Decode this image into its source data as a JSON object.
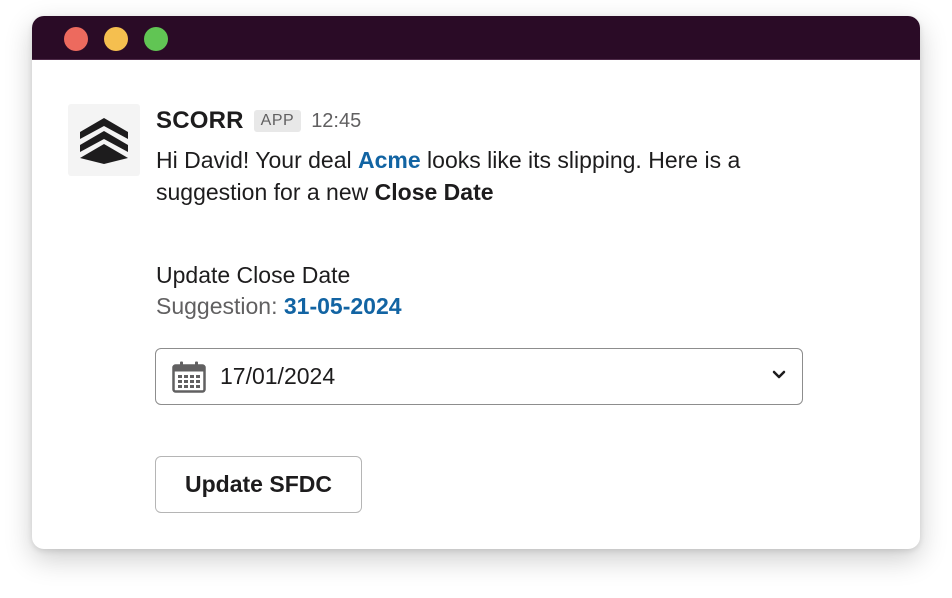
{
  "theme": {
    "titlebar": "#2a0b26",
    "close_dot": "#ed6a5e",
    "min_dot": "#f5bf4f",
    "max_dot": "#61c554",
    "link": "#1264a3"
  },
  "window_controls": [
    "close-dot",
    "minimize-dot",
    "maximize-dot"
  ],
  "message": {
    "avatar_icon": "chevron-stack-logo-icon",
    "sender": "SCORR",
    "badge": "APP",
    "time": "12:45",
    "text_part1": "Hi David! Your deal ",
    "deal_link": "Acme",
    "text_part2": " looks like its slipping. Here is a suggestion for a new ",
    "text_bold": "Close Date"
  },
  "section": {
    "title": "Update Close Date",
    "suggestion_label": "Suggestion: ",
    "suggestion_value": "31-05-2024"
  },
  "datepicker": {
    "icon": "calendar-icon",
    "value": "17/01/2024",
    "chevron": "chevron-down-icon"
  },
  "button": {
    "label": "Update SFDC"
  }
}
